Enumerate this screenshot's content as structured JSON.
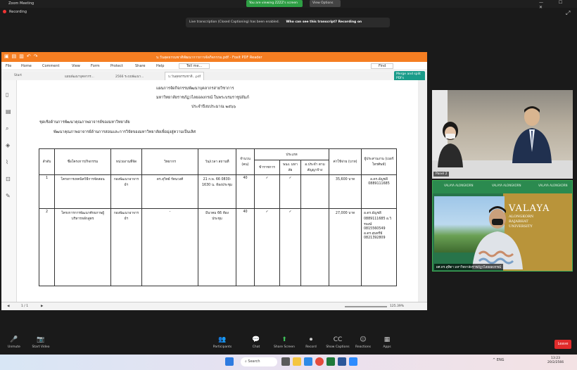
{
  "zoom": {
    "window_title": "Zoom Meeting",
    "share_banner": "You are viewing ZZZZ's screen",
    "view_options": "View Options",
    "recording": "Recording",
    "window_controls": "— ☐ ✕",
    "transcript_text": "Live transcription (Closed Captioning) has been enabled.",
    "transcript_link": "Who can see this transcript? Recording on"
  },
  "foxit": {
    "title": "บ.วันสุดธรรมชาติพัฒนาการการจัดกิจกรรม.pdf - Foxit PDF Reader",
    "menu": [
      "File",
      "Home",
      "Comment",
      "View",
      "Form",
      "Protect",
      "Share",
      "Help"
    ],
    "tell_me": "Tell me...",
    "find": "Find",
    "tabs": [
      "Start",
      "แผนพัฒนาบุคลากร...",
      "2566 ระบบพัฒนา...",
      "บ.วันสุดธรรมชาติ...pdf"
    ],
    "merge_button": "Merge and split PDFs",
    "page_indicator": "1 / 1",
    "zoom_level": "125.39%"
  },
  "document": {
    "heading1": "แผนการจัดกิจกรรมพัฒนาบุคลากรสายวิชาการ",
    "heading2": "มหาวิทยาลัยราชภัฏวไลยอลงกรณ์ ในพระบรมราชูปถัมภ์",
    "heading3": "ประจำปีงบประมาณ ๒๕๖๖",
    "section1": "ชุดเชิงด้านการพัฒนาคุณภาพอาจารย์ของมหาวิทยาลัย",
    "section2": "พัฒนาคุณภาพอาจารย์ด้านการสอนและการวิจัยของมหาวิทยาลัยเพื่อมุ่งสู่ความเป็นเลิศ",
    "table": {
      "headers": [
        "ลำดับ",
        "ชื่อโครงการ/กิจกรรม",
        "หน่วยงานที่จัด",
        "วิทยากร",
        "วัน/เวลา สถานที่",
        "จำนวน (คน)",
        "ประเภท",
        "ค่าใช้จ่าย (บาท)",
        "ผู้ประสานงาน (เบอร์โทรศัพท์)"
      ],
      "type_headers": [
        "ข้าราชการ",
        "พนง. มหาลัย",
        "อ.ประจำ ตามสัญญาจ้าง"
      ],
      "rows": [
        {
          "no": "1",
          "project": "โครงการเทคนิควิธีการจัดสอน",
          "unit": "กองพัฒนาอาจารย์ฯ",
          "speaker": "ดร.สุวิทย์ รัตนวงศ์",
          "datetime": "21 ก.พ. 66 0830-1630 น. ห้องประชุม",
          "count": "40",
          "check1": "✓",
          "check2": "✓",
          "check3": "",
          "cost": "35,600 บาท",
          "coordinator": "อ.ดร.อัญชลี 0889111685"
        },
        {
          "no": "2",
          "project": "โครงการการพัฒนาศักยภาพผู้บริหารหลักสูตร",
          "unit": "กองพัฒนาอาจารย์ฯ",
          "speaker": "-",
          "datetime": "มีนาคม 66 ห้องประชุม",
          "count": "40",
          "check1": "✓",
          "check2": "✓",
          "check3": "",
          "cost": "27,000 บาท",
          "coordinator": "อ.ดร.อัญชลี 0889111685 อ.วิรพงษ์ 0815560549 อ.ดร.สุนทรีย์ 0821392809"
        }
      ]
    }
  },
  "tiles": [
    {
      "name": "Panel 2"
    },
    {
      "name": "ผศ.ดร.สุทิตา มหาวิทยาลัยราชภัฏวไลยอลงกรณ์",
      "banner": [
        "VALAYA ALONGKORN",
        "VALAYA ALONGKORN",
        "VALAYA ALONGKORN"
      ],
      "logo": "VALAYA",
      "logo_sub": "ALONGKORN\nRAJABHAT\nUNIVERSITY"
    }
  ],
  "toolbar": [
    {
      "label": "Unmute",
      "icon": "🎤"
    },
    {
      "label": "Start Video",
      "icon": "📷"
    },
    {
      "label": "Participants",
      "icon": "👥"
    },
    {
      "label": "Chat",
      "icon": "💬"
    },
    {
      "label": "Share Screen",
      "icon": "⬆"
    },
    {
      "label": "Record",
      "icon": "⏺"
    },
    {
      "label": "Show Captions",
      "icon": "CC"
    },
    {
      "label": "Reactions",
      "icon": "☺"
    },
    {
      "label": "Apps",
      "icon": "▦"
    }
  ],
  "end_label": "Leave",
  "taskbar": {
    "search": "Search",
    "tray": "^  ENG",
    "time": "13:23",
    "date": "20/2/2566"
  },
  "colors": {
    "foxit_orange": "#f57e22",
    "zoom_green": "#2e9e44",
    "end_red": "#e02b2b",
    "valaya_gold": "#b9943a"
  }
}
